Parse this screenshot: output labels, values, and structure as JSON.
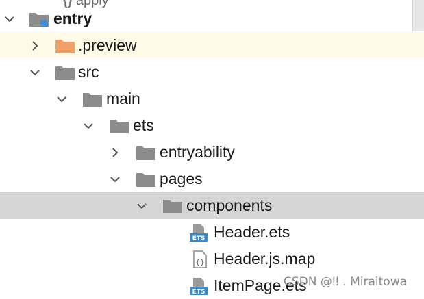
{
  "tree": {
    "partial_top_label": "{} apply",
    "rows": [
      {
        "label": "entry",
        "bold": true
      },
      {
        "label": ".preview"
      },
      {
        "label": "src"
      },
      {
        "label": "main"
      },
      {
        "label": "ets"
      },
      {
        "label": "entryability"
      },
      {
        "label": "pages"
      },
      {
        "label": "components"
      },
      {
        "label": "Header.ets",
        "badge": "ETS"
      },
      {
        "label": "Header.js.map",
        "badge": "{}"
      },
      {
        "label": "ItemPage.ets",
        "badge": "ETS"
      }
    ]
  },
  "watermark": "CSDN @ǃǃ . Miraitowa",
  "colors": {
    "folder_gray": "#8c8c8c",
    "folder_orange": "#f0a069",
    "module_blue": "#3d8fd8",
    "ets_blue": "#3b88c7",
    "selected_row": "#d5d5d5",
    "hover_row": "#fdfbe8"
  },
  "icons": {
    "chevron_expanded": "chevron-down-icon",
    "chevron_collapsed": "chevron-right-icon",
    "folder": "folder-icon",
    "module_folder": "module-folder-icon",
    "ets_file": "ets-file-icon",
    "json_file": "json-file-icon"
  }
}
